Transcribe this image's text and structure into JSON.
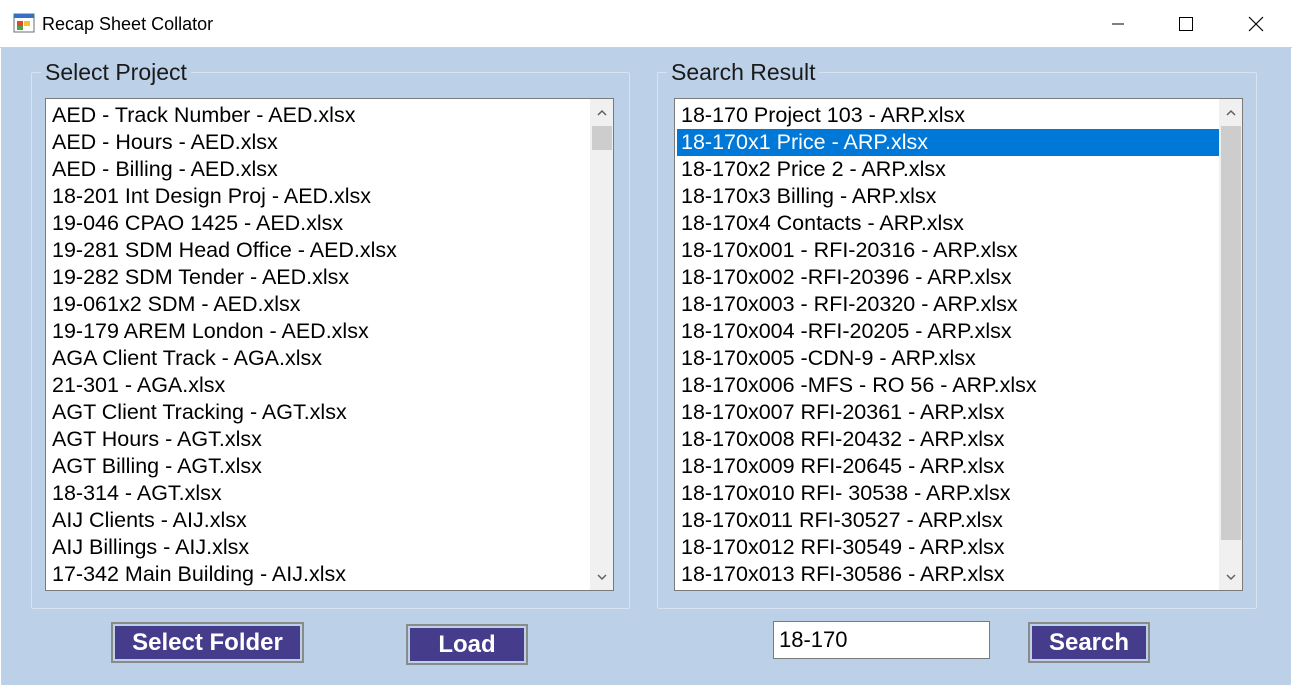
{
  "window": {
    "title": "Recap Sheet Collator",
    "minimize_icon": "minimize-icon",
    "maximize_icon": "maximize-icon",
    "close_icon": "close-icon"
  },
  "select_project": {
    "label": "Select Project",
    "items": [
      "AED -  Track Number  -  AED.xlsx",
      "AED - Hours  -  AED.xlsx",
      "AED - Billing  -  AED.xlsx",
      "18-201 Int Design Proj  -  AED.xlsx",
      "19-046 CPAO 1425  -  AED.xlsx",
      "19-281 SDM Head Office  -  AED.xlsx",
      "19-282 SDM Tender  -  AED.xlsx",
      "19-061x2 SDM  -  AED.xlsx",
      "19-179 AREM London  -  AED.xlsx",
      "AGA Client Track  -  AGA.xlsx",
      "21-301  -  AGA.xlsx",
      "AGT Client Tracking  -  AGT.xlsx",
      "AGT Hours  -  AGT.xlsx",
      "AGT Billing  -  AGT.xlsx",
      "18-314  -  AGT.xlsx",
      "AIJ Clients  -  AIJ.xlsx",
      "AIJ Billings  -  AIJ.xlsx",
      "17-342 Main Building  -  AIJ.xlsx"
    ],
    "scroll_position": 0.02
  },
  "search_result": {
    "label": "Search Result",
    "selected_index": 1,
    "items": [
      "18-170 Project 103  -  ARP.xlsx",
      "18-170x1 Price  -  ARP.xlsx",
      "18-170x2 Price 2  -  ARP.xlsx",
      "18-170x3 Billing  -  ARP.xlsx",
      "18-170x4 Contacts  -  ARP.xlsx",
      "18-170x001 - RFI-20316  -  ARP.xlsx",
      "18-170x002 -RFI-20396   -  ARP.xlsx",
      "18-170x003 -  RFI-20320  -  ARP.xlsx",
      "18-170x004 -RFI-20205  -  ARP.xlsx",
      "18-170x005 -CDN-9  -  ARP.xlsx",
      "18-170x006 -MFS - RO 56  -  ARP.xlsx",
      "18-170x007 RFI-20361  -  ARP.xlsx",
      "18-170x008 RFI-20432  -  ARP.xlsx",
      "18-170x009 RFI-20645  -  ARP.xlsx",
      "18-170x010 RFI- 30538  -  ARP.xlsx",
      "18-170x011 RFI-30527   -  ARP.xlsx",
      "18-170x012 RFI-30549  -  ARP.xlsx",
      "18-170x013 RFI-30586   -  ARP.xlsx"
    ],
    "scroll_position": 0.0
  },
  "buttons": {
    "select_folder": "Select Folder",
    "load": "Load",
    "search": "Search"
  },
  "search_input": {
    "value": "18-170"
  },
  "colors": {
    "client_background": "#bcd0e8",
    "button_background": "#463c8c",
    "selection": "#0078d7"
  }
}
